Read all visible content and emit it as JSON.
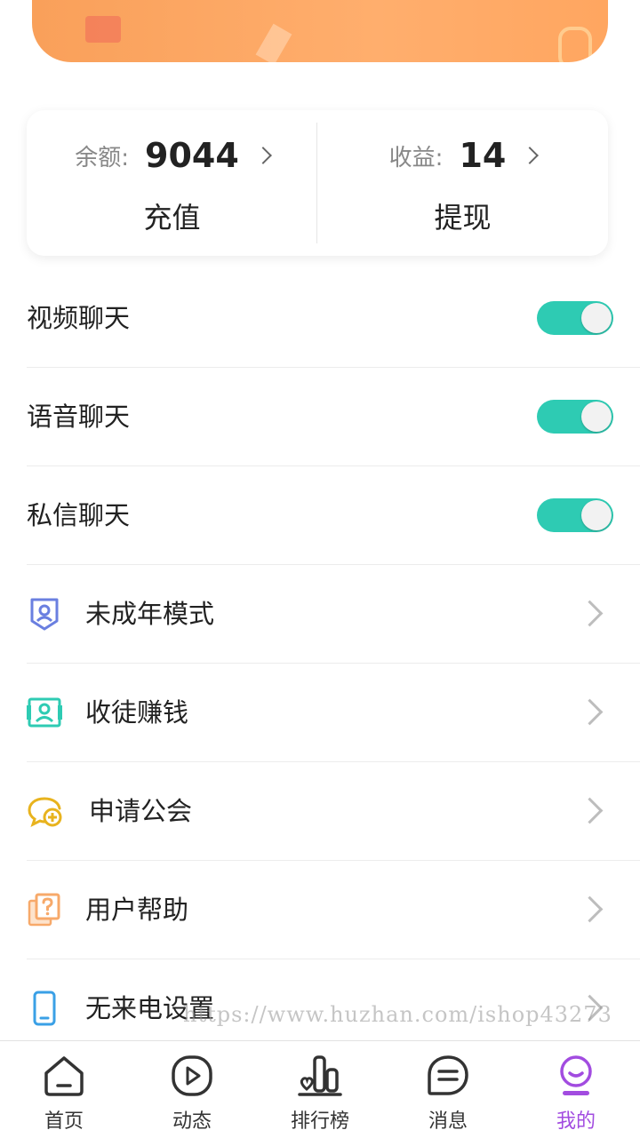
{
  "wallet": {
    "balance_label": "余额:",
    "balance_value": "9044",
    "recharge_label": "充值",
    "earnings_label": "收益:",
    "earnings_value": "14",
    "withdraw_label": "提现"
  },
  "toggles": [
    {
      "label": "视频聊天",
      "on": true
    },
    {
      "label": "语音聊天",
      "on": true
    },
    {
      "label": "私信聊天",
      "on": true
    }
  ],
  "menu": [
    {
      "label": "未成年模式",
      "icon": "shield-user-icon",
      "color": "#6a7fe0"
    },
    {
      "label": "收徒赚钱",
      "icon": "id-card-icon",
      "color": "#2ecbb3"
    },
    {
      "label": "申请公会",
      "icon": "chat-add-icon",
      "color": "#e8b31e"
    },
    {
      "label": "用户帮助",
      "icon": "help-doc-icon",
      "color": "#f7a96a"
    },
    {
      "label": "无来电设置",
      "icon": "phone-icon",
      "color": "#3aa0e6"
    }
  ],
  "watermark": "https://www.huzhan.com/ishop43273",
  "tabs": [
    {
      "label": "首页",
      "icon": "home-icon"
    },
    {
      "label": "动态",
      "icon": "play-icon"
    },
    {
      "label": "排行榜",
      "icon": "ranking-icon"
    },
    {
      "label": "消息",
      "icon": "message-icon"
    },
    {
      "label": "我的",
      "icon": "profile-icon",
      "active": true
    }
  ],
  "colors": {
    "accent": "#2ecbb3",
    "active_tab": "#a24ce0",
    "banner": "#ffae6d"
  }
}
